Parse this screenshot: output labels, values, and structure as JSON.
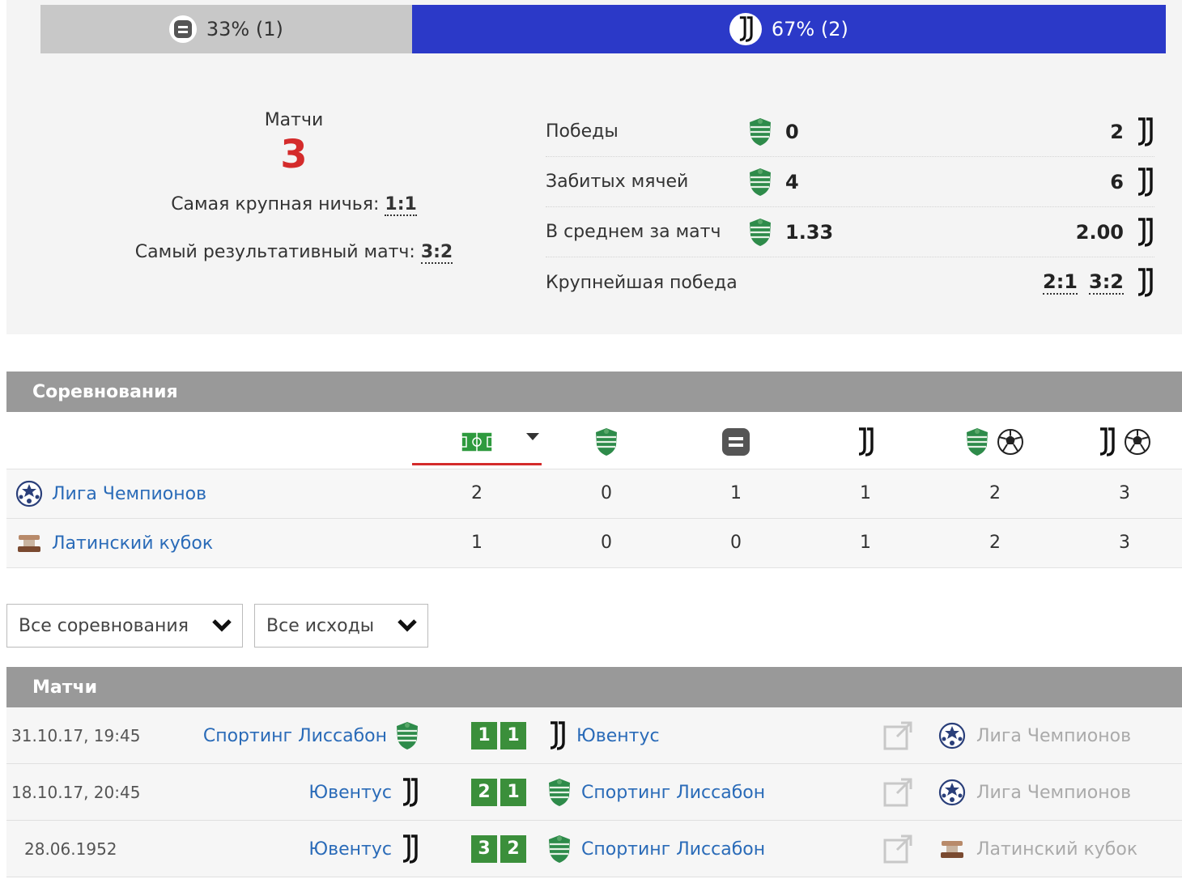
{
  "ratio": {
    "draw_label": "33% (1)",
    "juve_label": "67% (2)",
    "draw_share": 0.33,
    "juve_share": 0.67,
    "draw_color": "#c8c8c8",
    "juve_color": "#2b39c8"
  },
  "summary": {
    "matches_label": "Матчи",
    "matches_count": "3",
    "biggest_draw_label": "Самая крупная ничья:",
    "biggest_draw_value": "1:1",
    "highest_scoring_label": "Самый результативный матч:",
    "highest_scoring_value": "3:2"
  },
  "stats": [
    {
      "label": "Победы",
      "left": "0",
      "right": "2"
    },
    {
      "label": "Забитых мячей",
      "left": "4",
      "right": "6"
    },
    {
      "label": "В среднем за матч",
      "left": "1.33",
      "right": "2.00"
    },
    {
      "label": "Крупнейшая победа",
      "left": "",
      "right_a": "2:1",
      "right_b": "3:2"
    }
  ],
  "competitions": {
    "header": "Соревнования",
    "columns": [
      "matches-icon",
      "sporting-wins-icon",
      "draws-icon",
      "juventus-wins-icon",
      "sporting-goals-icon",
      "juventus-goals-icon"
    ],
    "rows": [
      {
        "name": "Лига Чемпионов",
        "icon": "champions-league-icon",
        "values": [
          "2",
          "0",
          "1",
          "1",
          "2",
          "3"
        ]
      },
      {
        "name": "Латинский кубок",
        "icon": "latin-cup-icon",
        "values": [
          "1",
          "0",
          "0",
          "1",
          "2",
          "3"
        ]
      }
    ]
  },
  "filters": {
    "competition": "Все соревнования",
    "outcome": "Все исходы"
  },
  "matches": {
    "header": "Матчи",
    "rows": [
      {
        "date": "31.10.17, 19:45",
        "home": "Спортинг Лиссабон",
        "home_icon": "sporting-crest-icon",
        "score_home": "1",
        "score_away": "1",
        "away": "Ювентус",
        "away_icon": "juventus-logo-icon",
        "competition": "Лига Чемпионов",
        "comp_icon": "champions-league-icon"
      },
      {
        "date": "18.10.17, 20:45",
        "home": "Ювентус",
        "home_icon": "juventus-logo-icon",
        "score_home": "2",
        "score_away": "1",
        "away": "Спортинг Лиссабон",
        "away_icon": "sporting-crest-icon",
        "competition": "Лига Чемпионов",
        "comp_icon": "champions-league-icon"
      },
      {
        "date": "28.06.1952",
        "home": "Ювентус",
        "home_icon": "juventus-logo-icon",
        "score_home": "3",
        "score_away": "2",
        "away": "Спортинг Лиссабон",
        "away_icon": "sporting-crest-icon",
        "competition": "Латинский кубок",
        "comp_icon": "latin-cup-icon"
      }
    ]
  },
  "colors": {
    "accent_red": "#d42b2b",
    "link_blue": "#2a6bb8",
    "score_green": "#3b8f3b",
    "header_grey": "#999999"
  }
}
